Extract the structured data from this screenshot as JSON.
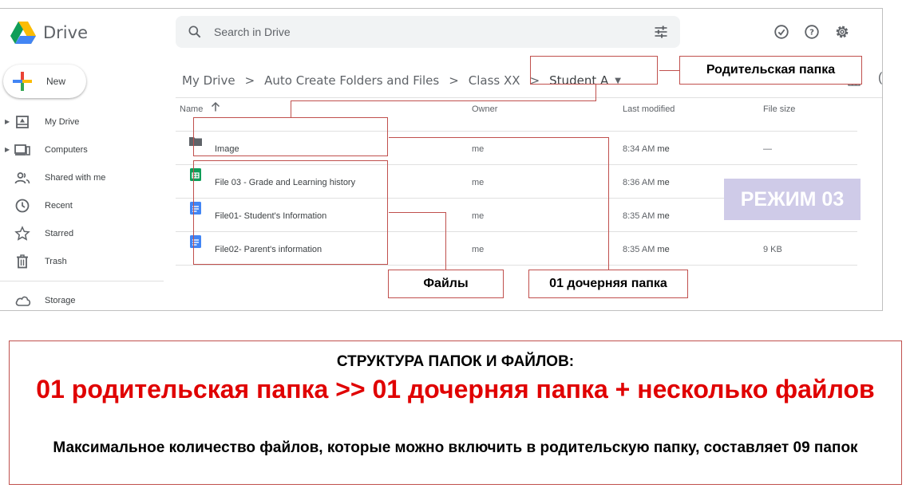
{
  "app": {
    "logo_text": "Drive"
  },
  "search": {
    "placeholder": "Search in Drive"
  },
  "new_button": {
    "label": "New"
  },
  "sidebar": {
    "items": [
      {
        "label": "My Drive"
      },
      {
        "label": "Computers"
      },
      {
        "label": "Shared with me"
      },
      {
        "label": "Recent"
      },
      {
        "label": "Starred"
      },
      {
        "label": "Trash"
      }
    ],
    "storage": "Storage"
  },
  "breadcrumb": {
    "items": [
      "My Drive",
      "Auto Create Folders and Files",
      "Class XX"
    ],
    "current": "Student A"
  },
  "table": {
    "columns": {
      "name": "Name",
      "owner": "Owner",
      "modified": "Last modified",
      "size": "File size"
    },
    "rows": [
      {
        "name": "Image",
        "owner": "me",
        "modified": "8:34 AM",
        "modified_by": "me",
        "size": "—",
        "type": "folder"
      },
      {
        "name": "File 03 - Grade and Learning history",
        "owner": "me",
        "modified": "8:36 AM",
        "modified_by": "me",
        "size": "",
        "type": "sheet"
      },
      {
        "name": "File01- Student's Information",
        "owner": "me",
        "modified": "8:35 AM",
        "modified_by": "me",
        "size": "",
        "type": "doc"
      },
      {
        "name": "File02- Parent's information",
        "owner": "me",
        "modified": "8:35 AM",
        "modified_by": "me",
        "size": "9 KB",
        "type": "doc"
      }
    ]
  },
  "annotations": {
    "parent_folder": "Родительская папка",
    "files": "Файлы",
    "child_folder": "01 дочерняя папка",
    "mode_badge": "РЕЖИМ 03"
  },
  "caption": {
    "title": "СТРУКТУРА ПАПОК И ФАЙЛОВ:",
    "main": "01 родительская папка >> 01 дочерняя папка + несколько файлов",
    "note": "Максимальное количество файлов, которые можно включить в родительскую папку, составляет 09 папок"
  },
  "colors": {
    "annotation": "#c0504d",
    "caption_accent": "#e00000",
    "badge_bg": "#cfcbe8"
  }
}
